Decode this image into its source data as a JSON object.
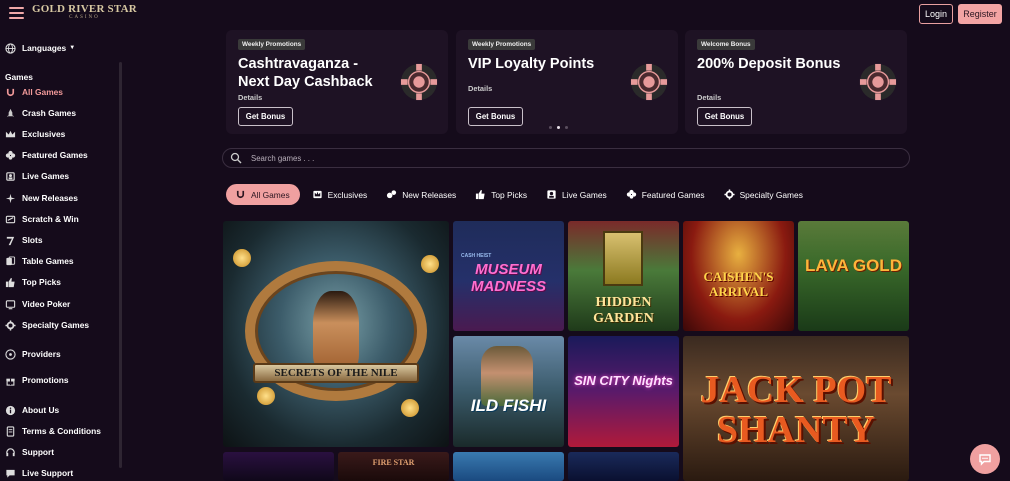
{
  "header": {
    "logo_text": "GOLD RIVER STAR",
    "logo_subtext": "CASINO",
    "login_label": "Login",
    "register_label": "Register"
  },
  "sidebar": {
    "languages_label": "Languages",
    "games_heading": "Games",
    "items": [
      {
        "label": "All Games",
        "icon": "horseshoe-icon",
        "active": true
      },
      {
        "label": "Crash Games",
        "icon": "rocket-icon"
      },
      {
        "label": "Exclusives",
        "icon": "crown-icon"
      },
      {
        "label": "Featured Games",
        "icon": "clover-icon"
      },
      {
        "label": "Live Games",
        "icon": "dealer-icon"
      },
      {
        "label": "New Releases",
        "icon": "sparkle-icon"
      },
      {
        "label": "Scratch & Win",
        "icon": "scratch-card-icon"
      },
      {
        "label": "Slots",
        "icon": "seven-icon"
      },
      {
        "label": "Table Games",
        "icon": "cards-icon"
      },
      {
        "label": "Top Picks",
        "icon": "thumbs-up-icon"
      },
      {
        "label": "Video Poker",
        "icon": "poker-icon"
      },
      {
        "label": "Specialty Games",
        "icon": "gear-icon"
      }
    ],
    "providers_label": "Providers",
    "promotions_label": "Promotions",
    "about_label": "About Us",
    "terms_label": "Terms & Conditions",
    "support_label": "Support",
    "live_support_label": "Live Support"
  },
  "promos": [
    {
      "tag": "Weekly Promotions",
      "title": "Cashtravaganza - Next Day Cashback",
      "details": "Details",
      "button": "Get Bonus"
    },
    {
      "tag": "Weekly Promotions",
      "title": "VIP Loyalty Points",
      "details": "Details",
      "button": "Get Bonus"
    },
    {
      "tag": "Welcome Bonus",
      "title": "200% Deposit Bonus",
      "details": "Details",
      "button": "Get Bonus"
    }
  ],
  "carousel": {
    "active_dot": 2,
    "dot_count": 3
  },
  "search": {
    "placeholder": "Search games . . ."
  },
  "tabs": [
    {
      "label": "All Games",
      "icon": "horseshoe-icon",
      "active": true
    },
    {
      "label": "Exclusives",
      "icon": "crown-icon"
    },
    {
      "label": "New Releases",
      "icon": "sparkle-icon"
    },
    {
      "label": "Top Picks",
      "icon": "thumbs-up-icon"
    },
    {
      "label": "Live Games",
      "icon": "dealer-icon"
    },
    {
      "label": "Featured Games",
      "icon": "clover-icon"
    },
    {
      "label": "Specialty Games",
      "icon": "gear-icon"
    }
  ],
  "games": {
    "nile": "SECRETS OF THE NILE",
    "museum_top": "CASH HEIST",
    "museum": "MUSEUM MADNESS",
    "garden": "HIDDEN GARDEN",
    "caishen": "CAISHEN'S ARRIVAL",
    "lava": "LAVA GOLD",
    "fishing": "ILD FISHI",
    "sincity": "SIN CITY Nights",
    "jackpot": "JACK POT SHANTY",
    "bottom2": "FIRE STAR"
  },
  "colors": {
    "accent": "#f0a0a0",
    "background": "#150b1b",
    "card": "#1e1224"
  }
}
